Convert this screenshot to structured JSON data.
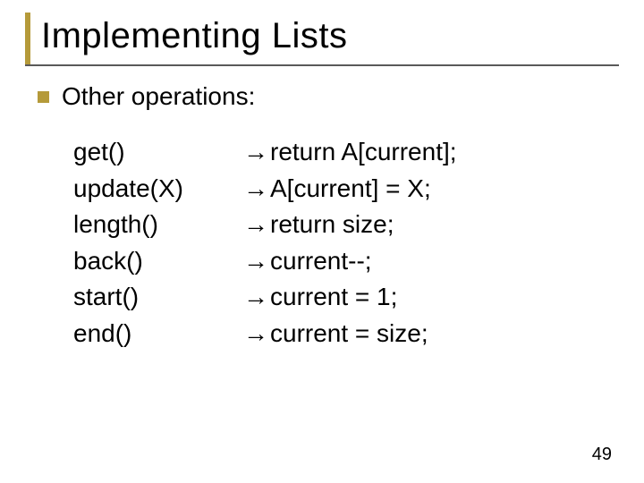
{
  "slide": {
    "title": "Implementing Lists",
    "bullet": "Other operations:",
    "arrow": "→",
    "operations": [
      {
        "name": "get()",
        "impl": "return A[current];"
      },
      {
        "name": "update(X)",
        "impl": "A[current] = X;"
      },
      {
        "name": "length()",
        "impl": " return size;"
      },
      {
        "name": "back()",
        "impl": "current--;"
      },
      {
        "name": "start()",
        "impl": "current = 1;"
      },
      {
        "name": "end()",
        "impl": "current = size;"
      }
    ],
    "page_number": "49"
  }
}
